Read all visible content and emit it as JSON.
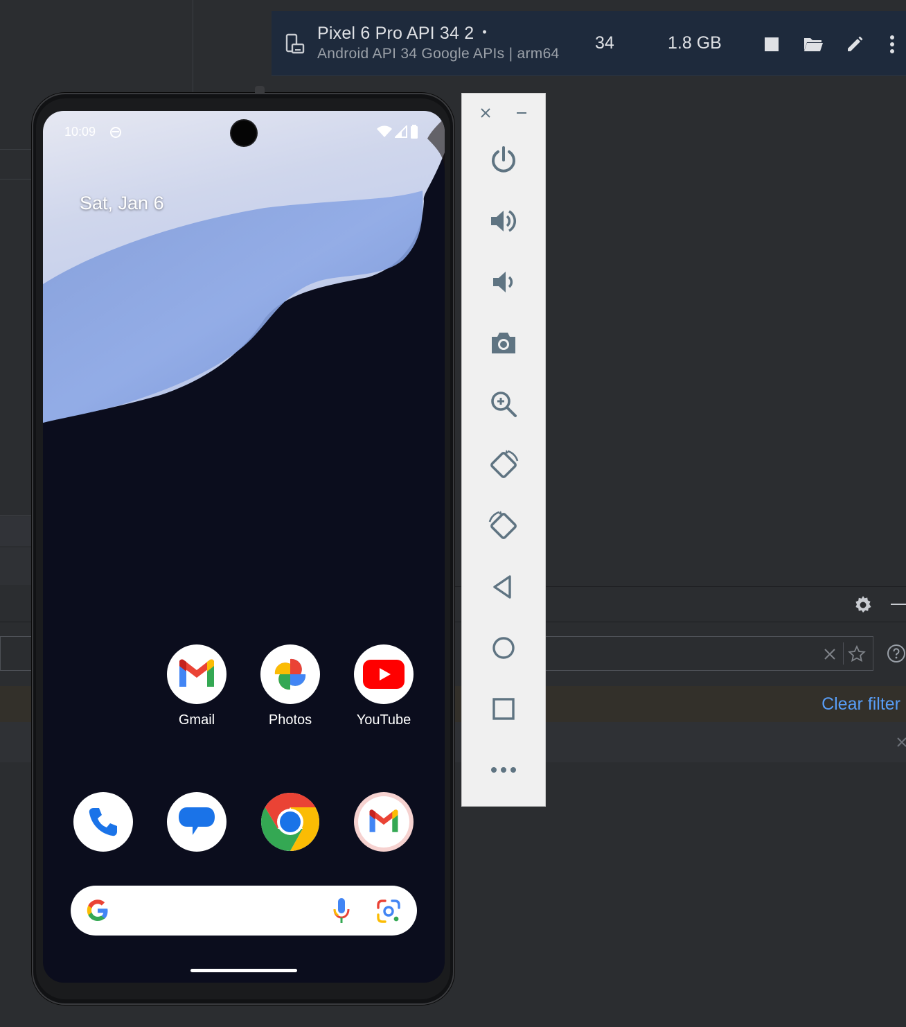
{
  "device": {
    "name": "Pixel 6 Pro API 34 2",
    "running_dot": "•",
    "subtitle": "Android API 34 Google APIs | arm64",
    "api": "34",
    "size": "1.8 GB"
  },
  "phone": {
    "status_time": "10:09",
    "date": "Sat, Jan 6",
    "apps_row1": [
      {
        "label": "Gmail",
        "icon": "gmail-icon"
      },
      {
        "label": "Photos",
        "icon": "photos-icon"
      },
      {
        "label": "YouTube",
        "icon": "youtube-icon"
      }
    ],
    "dock": [
      "phone-icon",
      "messages-icon",
      "chrome-icon",
      "gmail-go-icon"
    ]
  },
  "emulator_controls": [
    "close",
    "minimize",
    "power",
    "volume-up",
    "volume-down",
    "camera",
    "zoom",
    "rotate-left",
    "rotate-right",
    "back",
    "home",
    "overview",
    "more"
  ],
  "logcat": {
    "clear_filter": "Clear filter"
  },
  "colors": {
    "device_row_bg": "#1e2a3c",
    "link": "#589df6",
    "emu_icon": "#5f7482"
  }
}
